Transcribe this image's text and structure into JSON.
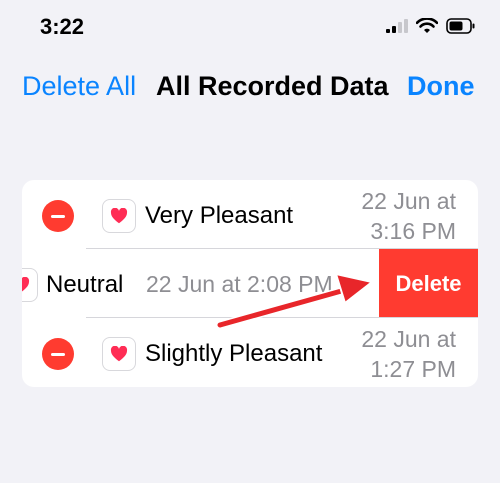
{
  "status_bar": {
    "time": "3:22",
    "icons": [
      "cellular-signal-icon",
      "wifi-icon",
      "battery-icon"
    ]
  },
  "nav": {
    "left_label": "Delete All",
    "title": "All Recorded Data",
    "right_label": "Done"
  },
  "records": [
    {
      "label": "Very Pleasant",
      "date_line1": "22 Jun at",
      "date_line2": "3:16 PM"
    },
    {
      "label": "Neutral",
      "date": "22 Jun at 2:08 PM",
      "action": "Delete"
    },
    {
      "label": "Slightly Pleasant",
      "date_line1": "22 Jun at",
      "date_line2": "1:27 PM"
    }
  ],
  "colors": {
    "accent": "#0a84ff",
    "destructive": "#ff3b30",
    "secondary_text": "#8e8e93",
    "background": "#f2f2f7",
    "annotation_arrow": "#e8262a"
  }
}
